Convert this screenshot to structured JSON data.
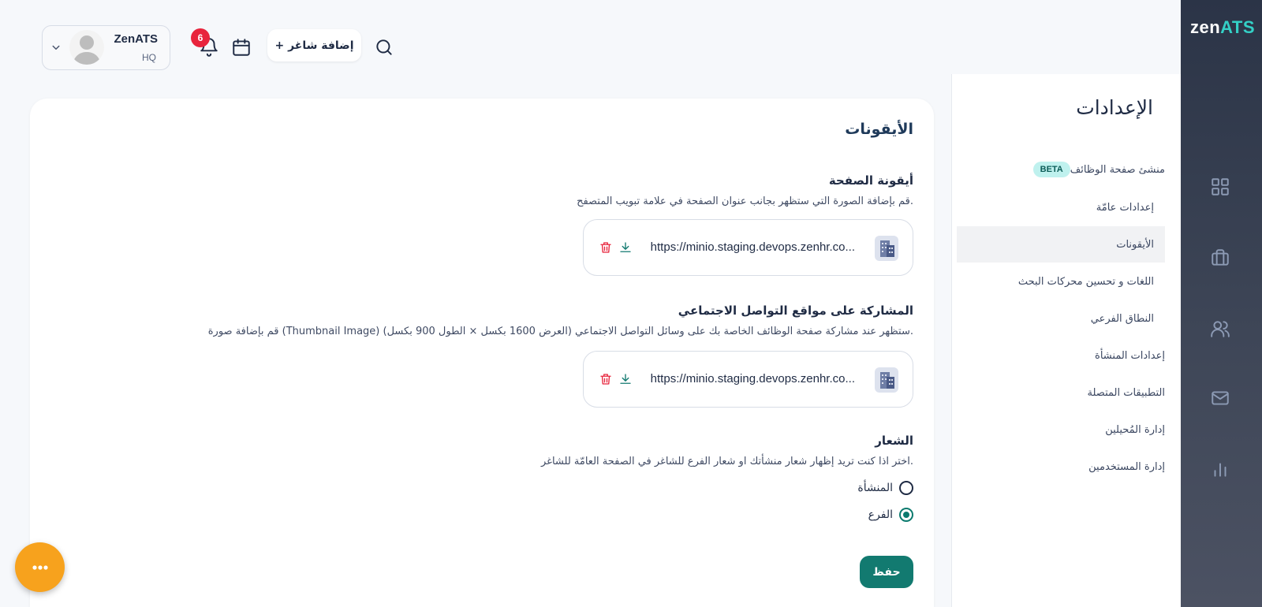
{
  "brand": {
    "logo_main": "zen",
    "logo_accent": "ATS"
  },
  "header": {
    "user_name": "ZenATS",
    "user_sub": "HQ",
    "notification_count": "6",
    "add_job_label": "+ إضافة شاغر"
  },
  "sidebar_icons": [
    "dashboard-icon",
    "briefcase-icon",
    "users-icon",
    "mail-icon",
    "bar-chart-icon"
  ],
  "settings_nav": {
    "title": "الإعدادات",
    "items": [
      {
        "label": "منشئ صفحة الوظائف",
        "badge": "BETA"
      },
      {
        "label": "إعدادات عامّة"
      },
      {
        "label": "الأيقونات",
        "active": true
      },
      {
        "label": "اللغات و تحسين محركات البحث"
      },
      {
        "label": "النطاق الفرعي"
      },
      {
        "label": "إعدادات المنشأة"
      },
      {
        "label": "التطبيقات المتصلة"
      },
      {
        "label": "إدارة المُحيلين"
      },
      {
        "label": "إدارة المستخدمين"
      }
    ]
  },
  "main": {
    "title": "الأيقونات",
    "favicon": {
      "title": "أيقونة الصفحة",
      "desc": "قم بإضافة الصورة التي ستظهر بجانب عنوان الصفحة في علامة تبويب المتصفح.",
      "url": "https://minio.staging.devops.zenhr.co..."
    },
    "social": {
      "title": "المشاركة على مواقع التواصل الاجتماعي",
      "desc": "قم بإضافة صورة (Thumbnail Image) ستظهر عند مشاركة صفحة الوظائف الخاصة بك على وسائل التواصل الاجتماعي (العرض 1600 بكسل × الطول 900 بكسل).",
      "url": "https://minio.staging.devops.zenhr.co..."
    },
    "logo": {
      "title": "الشعار",
      "desc": "اختر اذا كنت تريد إظهار شعار منشأتك او شعار الفرع للشاغر في الصفحة العامّة للشاغر.",
      "options": [
        {
          "label": "المنشأة",
          "selected": false
        },
        {
          "label": "الفرع",
          "selected": true
        }
      ]
    },
    "save_label": "حفظ"
  },
  "colors": {
    "accent": "#127a70",
    "rail": "#2b3447",
    "badge": "#e8243c",
    "fab": "#f7a21d",
    "beta_bg": "#bff1ee"
  }
}
